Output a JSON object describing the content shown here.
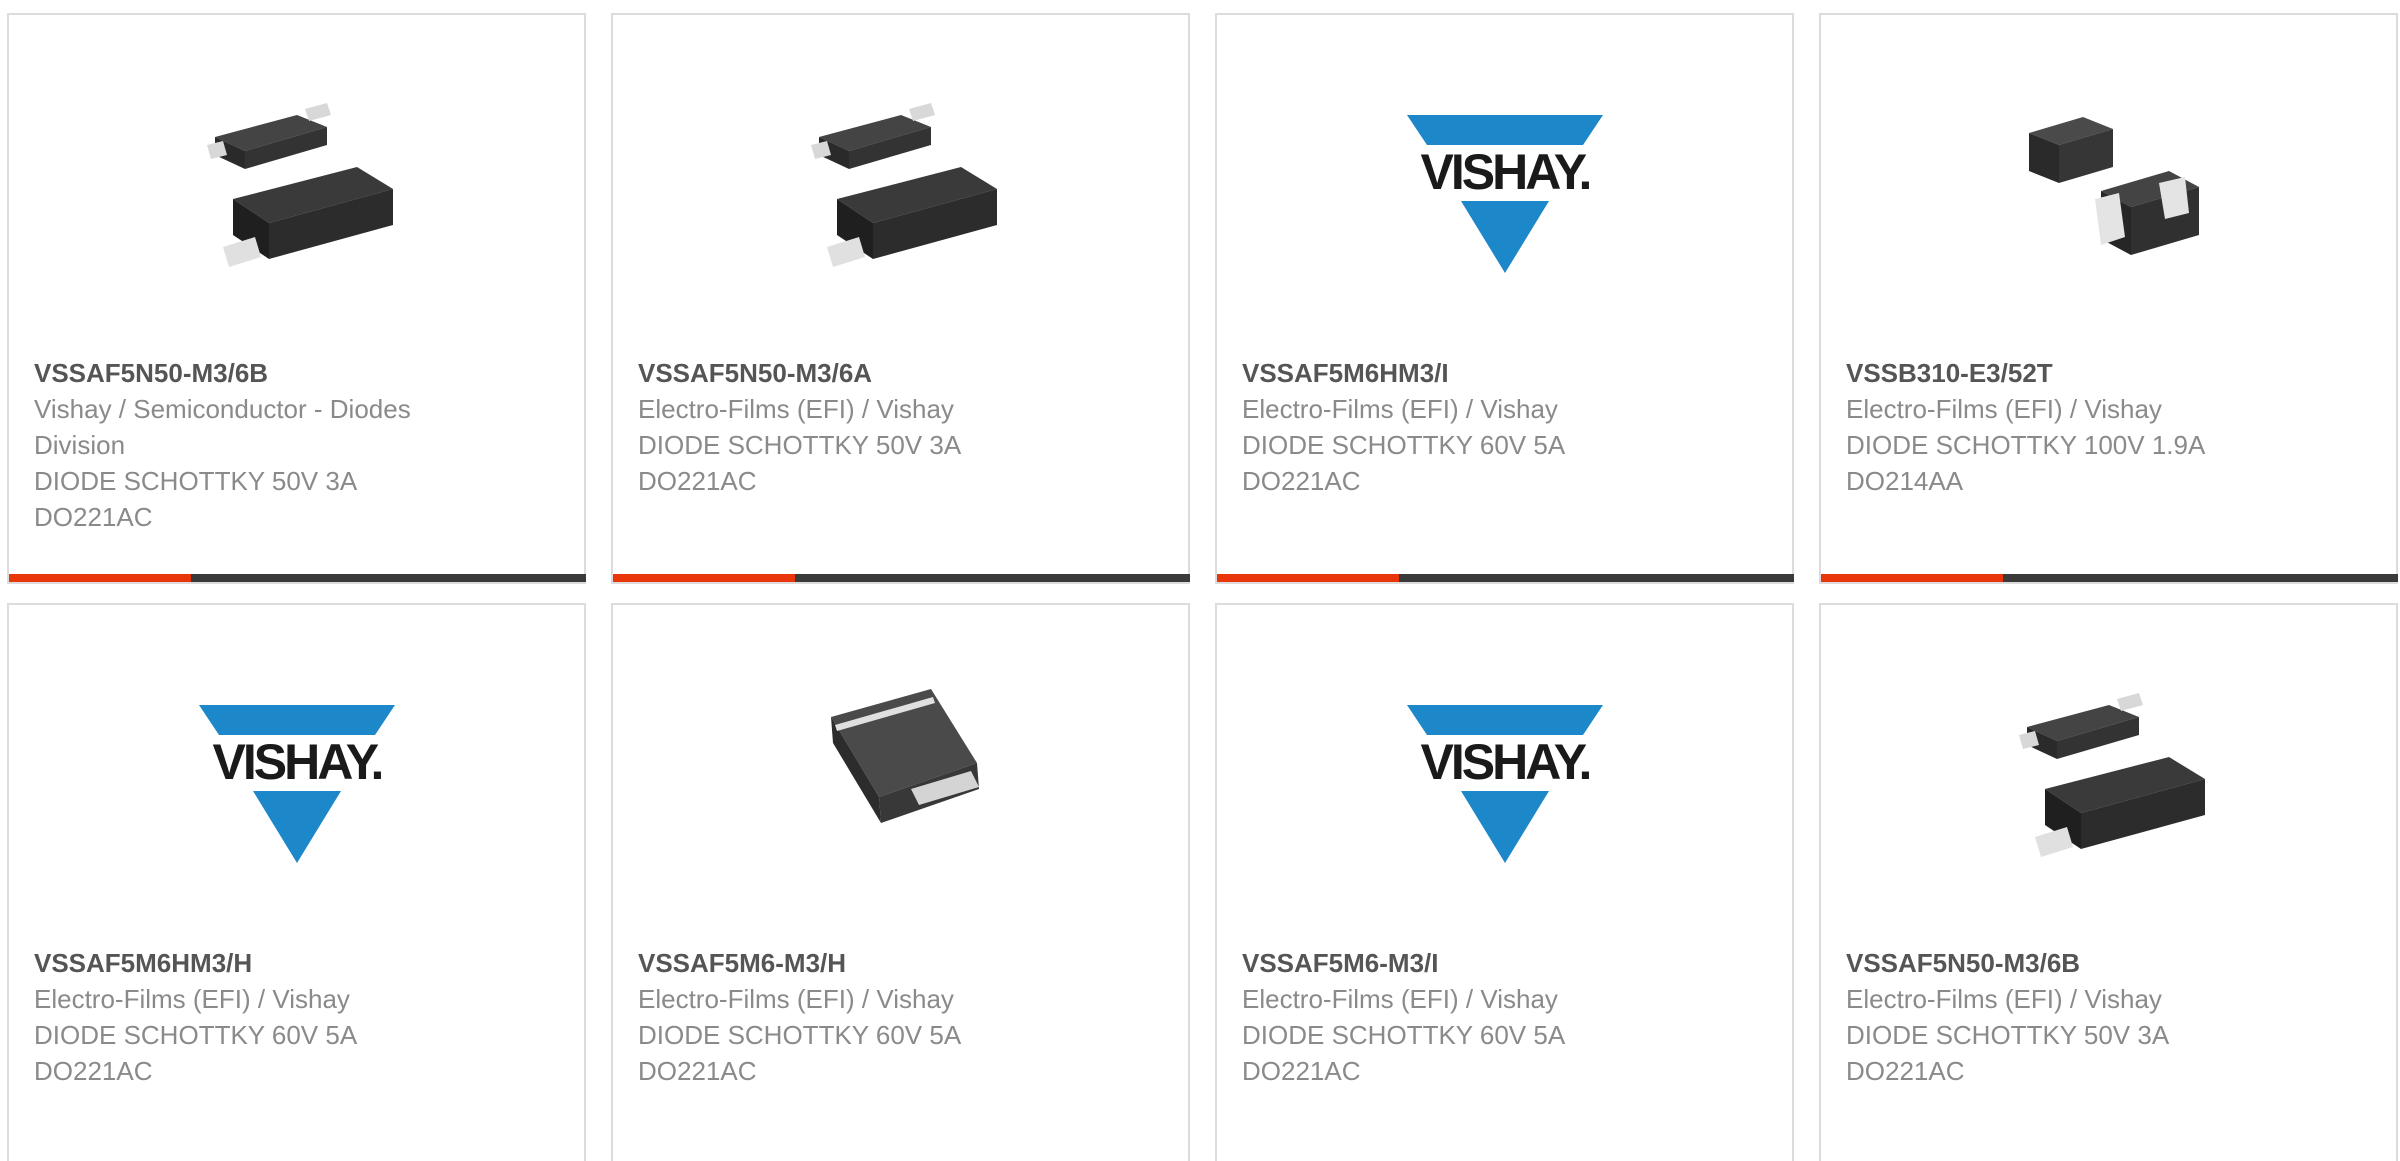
{
  "colors": {
    "accent": "#e8360a",
    "bar": "#3a3a3a",
    "border": "#dcdcdc",
    "vishay_blue": "#1c87c9"
  },
  "cards": [
    {
      "part": "VSSAF5N50-M3/6B",
      "lines": [
        "Vishay / Semiconductor - Diodes Division",
        "DIODE SCHOTTKY 50V 3A",
        "DO221AC"
      ],
      "image": "smd-diode-pair-image"
    },
    {
      "part": "VSSAF5N50-M3/6A",
      "lines": [
        "Electro-Films (EFI) / Vishay",
        "DIODE SCHOTTKY 50V 3A",
        "DO221AC"
      ],
      "image": "smd-diode-pair-image"
    },
    {
      "part": "VSSAF5M6HM3/I",
      "lines": [
        "Electro-Films (EFI) / Vishay",
        "DIODE SCHOTTKY 60V 5A",
        "DO221AC"
      ],
      "image": "vishay-logo",
      "logo_text": "VISHAY."
    },
    {
      "part": "VSSB310-E3/52T",
      "lines": [
        "Electro-Films (EFI) / Vishay",
        "DIODE SCHOTTKY 100V 1.9A",
        "DO214AA"
      ],
      "image": "smb-diode-pair-image"
    },
    {
      "part": "VSSAF5M6HM3/H",
      "lines": [
        "Electro-Films (EFI) / Vishay",
        "DIODE SCHOTTKY 60V 5A",
        "DO221AC"
      ],
      "image": "vishay-logo",
      "logo_text": "VISHAY."
    },
    {
      "part": "VSSAF5M6-M3/H",
      "lines": [
        "Electro-Films (EFI) / Vishay",
        "DIODE SCHOTTKY 60V 5A",
        "DO221AC"
      ],
      "image": "smd-diode-single-image"
    },
    {
      "part": "VSSAF5M6-M3/I",
      "lines": [
        "Electro-Films (EFI) / Vishay",
        "DIODE SCHOTTKY 60V 5A",
        "DO221AC"
      ],
      "image": "vishay-logo",
      "logo_text": "VISHAY."
    },
    {
      "part": "VSSAF5N50-M3/6B",
      "lines": [
        "Electro-Films (EFI) / Vishay",
        "DIODE SCHOTTKY 50V 3A",
        "DO221AC"
      ],
      "image": "smd-diode-pair-image"
    }
  ]
}
